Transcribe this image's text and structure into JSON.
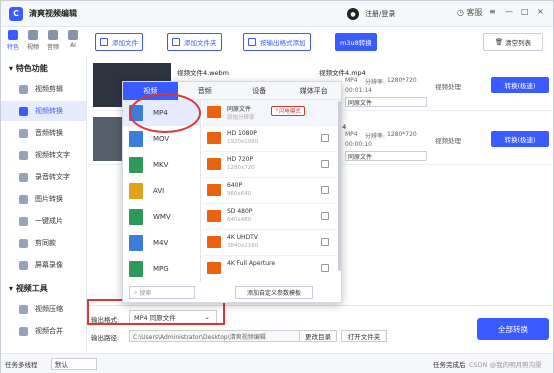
{
  "app": {
    "title": "清爽视频编辑",
    "logo_text": "C"
  },
  "header": {
    "user_label": "注册/登录",
    "service_label": "客服",
    "menu_label": "≡",
    "minimize_label": "—",
    "maximize_label": "□",
    "close_label": "×"
  },
  "top_tabs": [
    {
      "label": "特色"
    },
    {
      "label": "视频"
    },
    {
      "label": "音频"
    },
    {
      "label": "AI"
    }
  ],
  "sidebar": {
    "section1": "特色功能",
    "items": [
      {
        "label": "视频剪辑"
      },
      {
        "label": "视频转换"
      },
      {
        "label": "音频转换"
      },
      {
        "label": "视频转文字"
      },
      {
        "label": "录音转文字"
      },
      {
        "label": "图片转换"
      },
      {
        "label": "一键成片"
      },
      {
        "label": "剪同款"
      },
      {
        "label": "屏幕录像"
      }
    ],
    "section2": "视频工具",
    "items2": [
      {
        "label": "视频压缩"
      },
      {
        "label": "视频合并"
      }
    ]
  },
  "toolbar": {
    "add_file": "添加文件",
    "add_folder": "添加文件夹",
    "add_by_format": "按输出格式添加",
    "m3u8": "m3u8转换",
    "clear": "清空列表"
  },
  "files": [
    {
      "name": "视频文件4.webm",
      "out_name": "视频文件4.mp4",
      "fmt": "MP4",
      "res_label": "分辨率:",
      "res": "1280*720",
      "duration": "00:01:14",
      "preset": "同原文件",
      "process": "视频处理",
      "convert": "转换(极速)"
    },
    {
      "name": "",
      "out_name": "件5.mp4",
      "fmt": "MP4",
      "res_label": "分辨率:",
      "res": "1280*720",
      "duration": "00:00:10",
      "preset": "同原文件",
      "process": "视频处理",
      "convert": "转换(极速)"
    }
  ],
  "popup": {
    "tabs": [
      "视频",
      "音频",
      "设备",
      "媒体平台"
    ],
    "formats": [
      "MP4",
      "MOV",
      "MKV",
      "AVI",
      "WMV",
      "M4V",
      "MPG"
    ],
    "presets": [
      {
        "name": "同原文件",
        "sub": "原始分辨率"
      },
      {
        "name": "HD 1080P",
        "sub": "1920x1080"
      },
      {
        "name": "HD 720P",
        "sub": "1280x720"
      },
      {
        "name": "640P",
        "sub": "960x640"
      },
      {
        "name": "SD 480P",
        "sub": "640x480"
      },
      {
        "name": "4K UHDTV",
        "sub": "3840x2160"
      },
      {
        "name": "4K Full Aperture",
        "sub": ""
      }
    ],
    "badge": "闪电模式",
    "search_placeholder": "搜索",
    "add_preset": "添加自定义参数模板"
  },
  "bottom": {
    "out_format_label": "输出格式:",
    "out_format_value": "MP4 同原文件",
    "out_path_label": "输出路径:",
    "out_path_value": "C:\\Users\\Administrator\\Desktop\\清爽视频编辑",
    "change_dir": "更改目录",
    "open_dir": "打开文件夹",
    "convert_all": "全部转换"
  },
  "statusbar": {
    "tasks_label": "任务多线程",
    "tasks_value": "默认",
    "done_label": "任务完成后",
    "watermark": "CSDN @我的明月照沟渠"
  }
}
